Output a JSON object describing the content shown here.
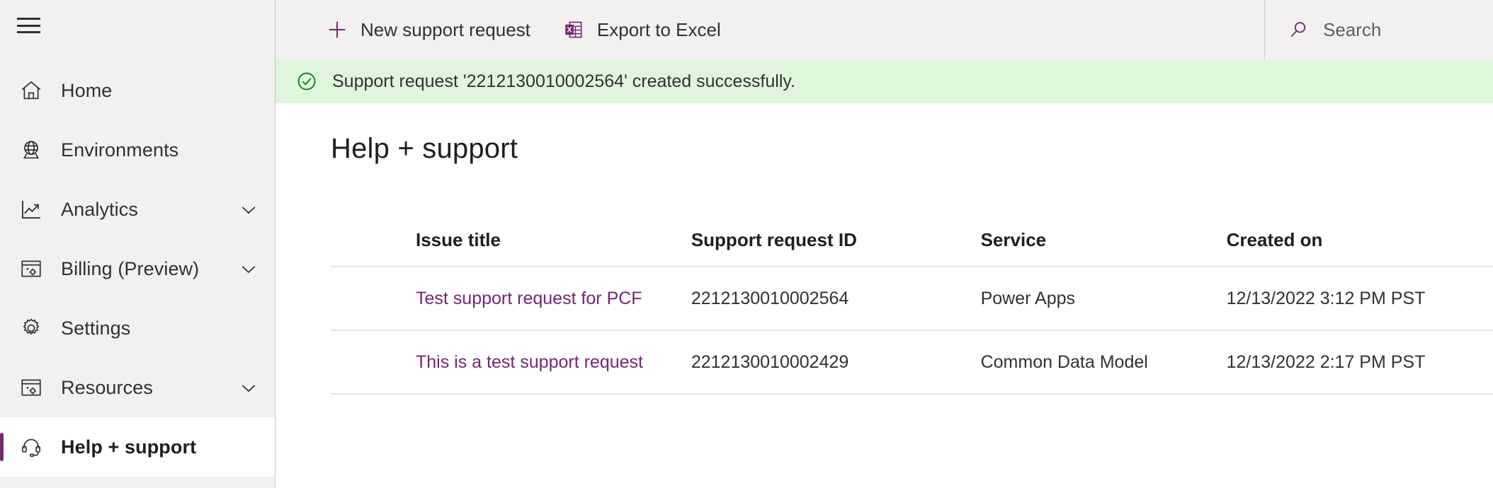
{
  "sidebar": {
    "menu_button": "menu-icon",
    "items": [
      {
        "label": "Home",
        "icon": "home-icon",
        "expandable": false,
        "selected": false
      },
      {
        "label": "Environments",
        "icon": "globe-icon",
        "expandable": false,
        "selected": false
      },
      {
        "label": "Analytics",
        "icon": "analytics-icon",
        "expandable": true,
        "selected": false
      },
      {
        "label": "Billing (Preview)",
        "icon": "billing-icon",
        "expandable": true,
        "selected": false
      },
      {
        "label": "Settings",
        "icon": "gear-icon",
        "expandable": false,
        "selected": false
      },
      {
        "label": "Resources",
        "icon": "resources-icon",
        "expandable": true,
        "selected": false
      },
      {
        "label": "Help + support",
        "icon": "headset-icon",
        "expandable": false,
        "selected": true
      }
    ]
  },
  "command_bar": {
    "new_request_label": "New support request",
    "export_label": "Export to Excel"
  },
  "search": {
    "placeholder": "Search",
    "value": ""
  },
  "banner": {
    "text": "Support request '2212130010002564' created successfully.",
    "icon": "check-circle-icon",
    "background": "#dff6dd",
    "icon_color": "#107c10"
  },
  "page": {
    "title": "Help + support"
  },
  "table": {
    "columns": [
      "Issue title",
      "Support request ID",
      "Service",
      "Created on"
    ],
    "rows": [
      {
        "issue_title": "Test support request for PCF",
        "support_request_id": "2212130010002564",
        "service": "Power Apps",
        "created_on": "12/13/2022 3:12 PM PST"
      },
      {
        "issue_title": "This is a test support request",
        "support_request_id": "2212130010002429",
        "service": "Common Data Model",
        "created_on": "12/13/2022 2:17 PM PST"
      }
    ]
  },
  "colors": {
    "accent_purple": "#742774",
    "link_purple": "#742774",
    "sidebar_bg": "#f2f1f0",
    "success_green": "#107c10",
    "text_primary": "#323130"
  }
}
